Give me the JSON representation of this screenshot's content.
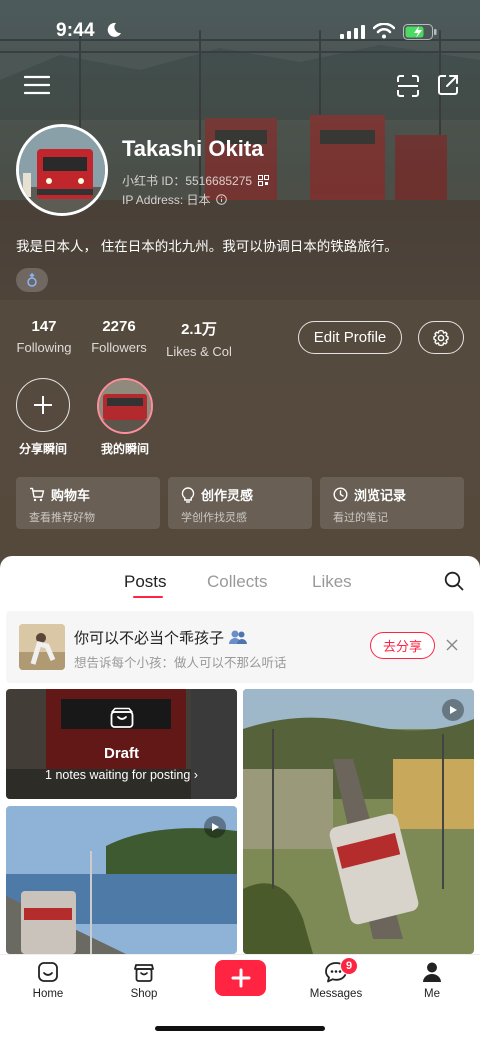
{
  "status_bar": {
    "time": "9:44"
  },
  "profile": {
    "name": "Takashi Okita",
    "id_line": "小红书 ID：5516685275",
    "ip_line": "IP Address: 日本",
    "bio": "我是日本人， 住在日本的北九州。我可以协调日本的铁路旅行。",
    "stats": [
      {
        "value": "147",
        "label": "Following"
      },
      {
        "value": "2276",
        "label": "Followers"
      },
      {
        "value": "2.1万",
        "label": "Likes & Col"
      }
    ],
    "edit_label": "Edit Profile"
  },
  "moments": {
    "add_label": "分享瞬间",
    "mine_label": "我的瞬间"
  },
  "quick_links": [
    {
      "title": "购物车",
      "sub": "查看推荐好物",
      "icon": "cart-icon"
    },
    {
      "title": "创作灵感",
      "sub": "学创作找灵感",
      "icon": "lightbulb-icon"
    },
    {
      "title": "浏览记录",
      "sub": "看过的笔记",
      "icon": "clock-icon"
    }
  ],
  "tabs": {
    "posts": "Posts",
    "collects": "Collects",
    "likes": "Likes"
  },
  "promo": {
    "title": "你可以不必当个乖孩子",
    "subtitle": "想告诉每个小孩：做人可以不那么听话",
    "button": "去分享"
  },
  "draft": {
    "title": "Draft",
    "subtitle": "1 notes waiting for posting"
  },
  "tabbar": {
    "home": "Home",
    "shop": "Shop",
    "messages": "Messages",
    "messages_badge": "9",
    "me": "Me"
  },
  "colors": {
    "accent": "#ff2442",
    "header_bg": "#55493c"
  }
}
